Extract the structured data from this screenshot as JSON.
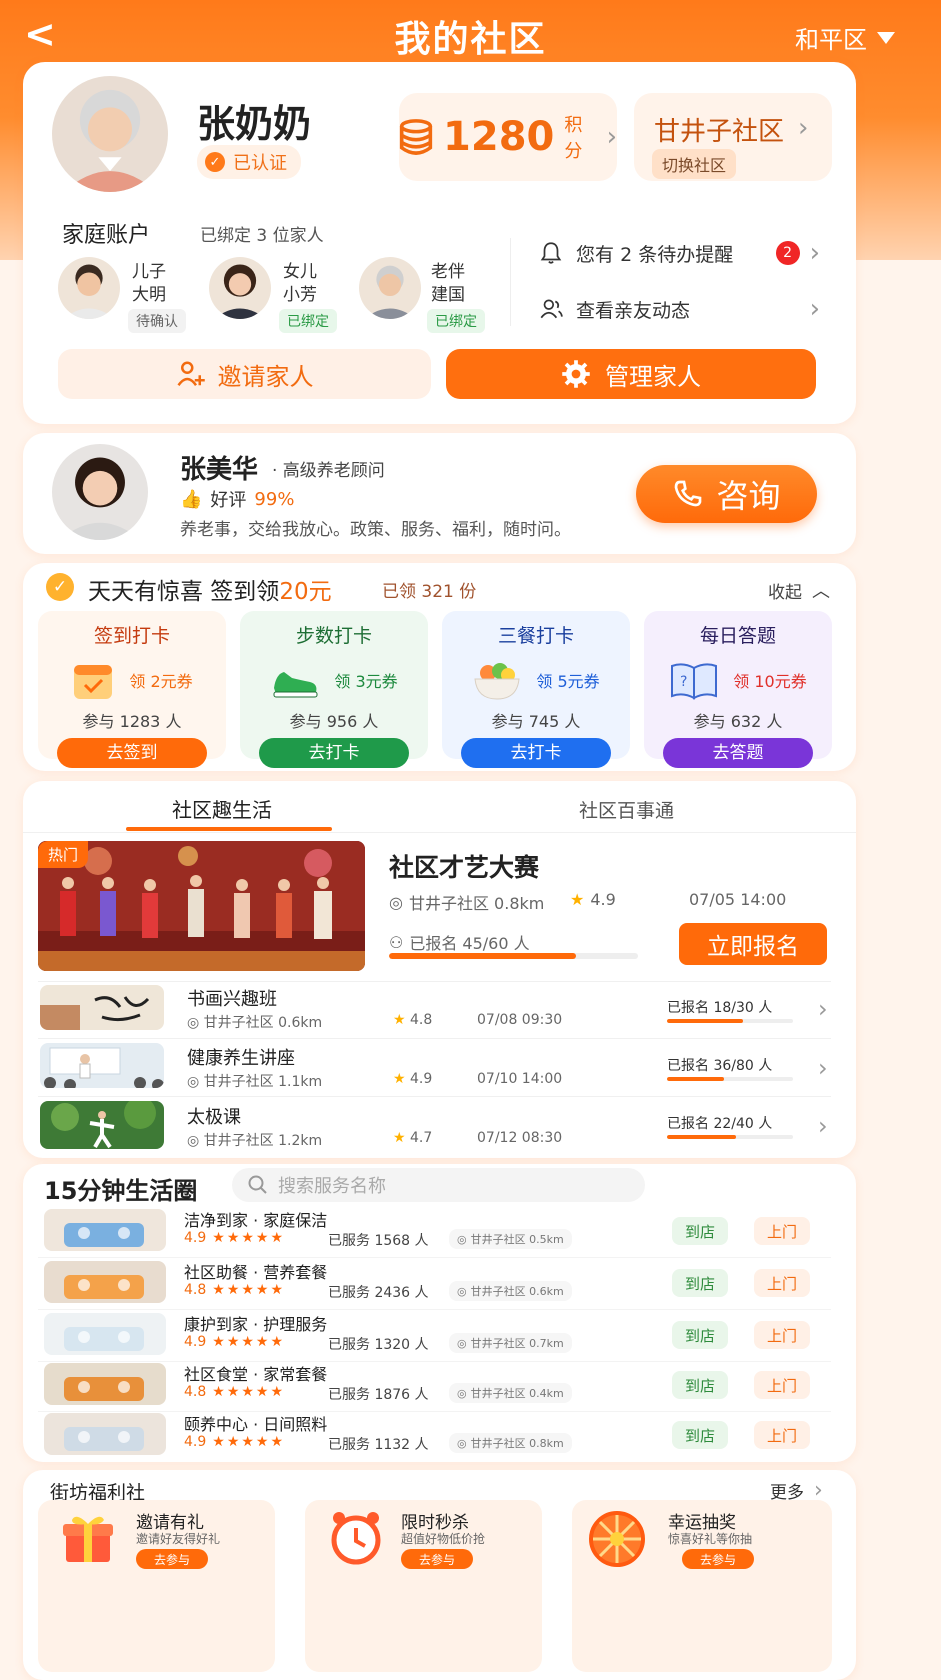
{
  "header": {
    "title": "我的社区",
    "back": "<",
    "area": "和平区"
  },
  "profile": {
    "name": "张奶奶",
    "verified": "已认证",
    "points": "1280",
    "points_unit": "积分",
    "community": "甘井子社区",
    "switch_label": "切换社区"
  },
  "family": {
    "title": "家庭账户",
    "bound_prefix": "已绑定",
    "bound_count": "3",
    "bound_suffix": "位家人",
    "members": [
      {
        "rel": "儿子",
        "name": "大明",
        "status": "待确认"
      },
      {
        "rel": "女儿",
        "name": "小芳",
        "status": "已绑定"
      },
      {
        "rel": "老伴",
        "name": "建国",
        "status": "已绑定"
      }
    ],
    "reminders_a": "您有",
    "reminders_count": "2",
    "reminders_b": "条待办提醒",
    "reminder_badge": "2",
    "friends": "查看亲友动态",
    "invite": "邀请家人",
    "manage": "管理家人"
  },
  "advisor": {
    "name": "张美华",
    "title": "· 高级养老顾问",
    "rating_label": "好评",
    "rating": "99%",
    "desc": "养老事，交给我放心。政策、服务、福利，随时问。",
    "consult": "咨询"
  },
  "checkin": {
    "title_a": "天天有惊喜 签到领",
    "title_b": "20元",
    "got_a": "已领",
    "got_count": "321",
    "got_b": "份",
    "fold": "收起",
    "tasks": [
      {
        "title": "签到打卡",
        "coupon": "领 2元券",
        "participants": "参与 1283 人",
        "button": "去签到",
        "color": "#ff6a0a"
      },
      {
        "title": "步数打卡",
        "coupon": "领 3元券",
        "participants": "参与 956 人",
        "button": "去打卡",
        "color": "#1f9a4a"
      },
      {
        "title": "三餐打卡",
        "coupon": "领 5元券",
        "participants": "参与 745 人",
        "button": "去打卡",
        "color": "#1f6ff0"
      },
      {
        "title": "每日答题",
        "coupon": "领 10元券",
        "participants": "参与 632 人",
        "button": "去答题",
        "color": "#7a35d8"
      }
    ]
  },
  "tabs": [
    "社区趣生活",
    "社区百事通"
  ],
  "featured": {
    "hot": "热门",
    "title": "社区才艺大赛",
    "location": "甘井子社区 0.8km",
    "rating": "4.9",
    "time": "07/05 14:00",
    "enrolled": "已报名 45/60 人",
    "progress": 0.75,
    "button": "立即报名"
  },
  "activities": [
    {
      "title": "书画兴趣班",
      "location": "甘井子社区 0.6km",
      "rating": "4.8",
      "time": "07/08 09:30",
      "enrolled": "已报名 18/30 人",
      "progress": 0.6
    },
    {
      "title": "健康养生讲座",
      "location": "甘井子社区 1.1km",
      "rating": "4.9",
      "time": "07/10 14:00",
      "enrolled": "已报名 36/80 人",
      "progress": 0.45
    },
    {
      "title": "太极课",
      "location": "甘井子社区 1.2km",
      "rating": "4.7",
      "time": "07/12 08:30",
      "enrolled": "已报名 22/40 人",
      "progress": 0.55
    }
  ],
  "life": {
    "title": "15分钟生活圈",
    "search_placeholder": "搜索服务名称",
    "store": "到店",
    "home": "上门",
    "services": [
      {
        "name": "洁净到家 · 家庭保洁",
        "rating": "4.9",
        "served": "已服务 1568 人",
        "location": "甘井子社区 0.5km"
      },
      {
        "name": "社区助餐 · 营养套餐",
        "rating": "4.8",
        "served": "已服务 2436 人",
        "location": "甘井子社区 0.6km"
      },
      {
        "name": "康护到家 · 护理服务",
        "rating": "4.9",
        "served": "已服务 1320 人",
        "location": "甘井子社区 0.7km"
      },
      {
        "name": "社区食堂 · 家常套餐",
        "rating": "4.8",
        "served": "已服务 1876 人",
        "location": "甘井子社区 0.4km"
      },
      {
        "name": "颐养中心 · 日间照料",
        "rating": "4.9",
        "served": "已服务 1132 人",
        "location": "甘井子社区 0.8km"
      }
    ]
  },
  "welfare": {
    "title": "街坊福利社",
    "more": "更多",
    "items": [
      {
        "title": "邀请有礼",
        "sub": "邀请好友得好礼",
        "button": "去参与"
      },
      {
        "title": "限时秒杀",
        "sub": "超值好物低价抢",
        "button": "去参与"
      },
      {
        "title": "幸运抽奖",
        "sub": "惊喜好礼等你抽",
        "button": "去参与"
      }
    ]
  }
}
